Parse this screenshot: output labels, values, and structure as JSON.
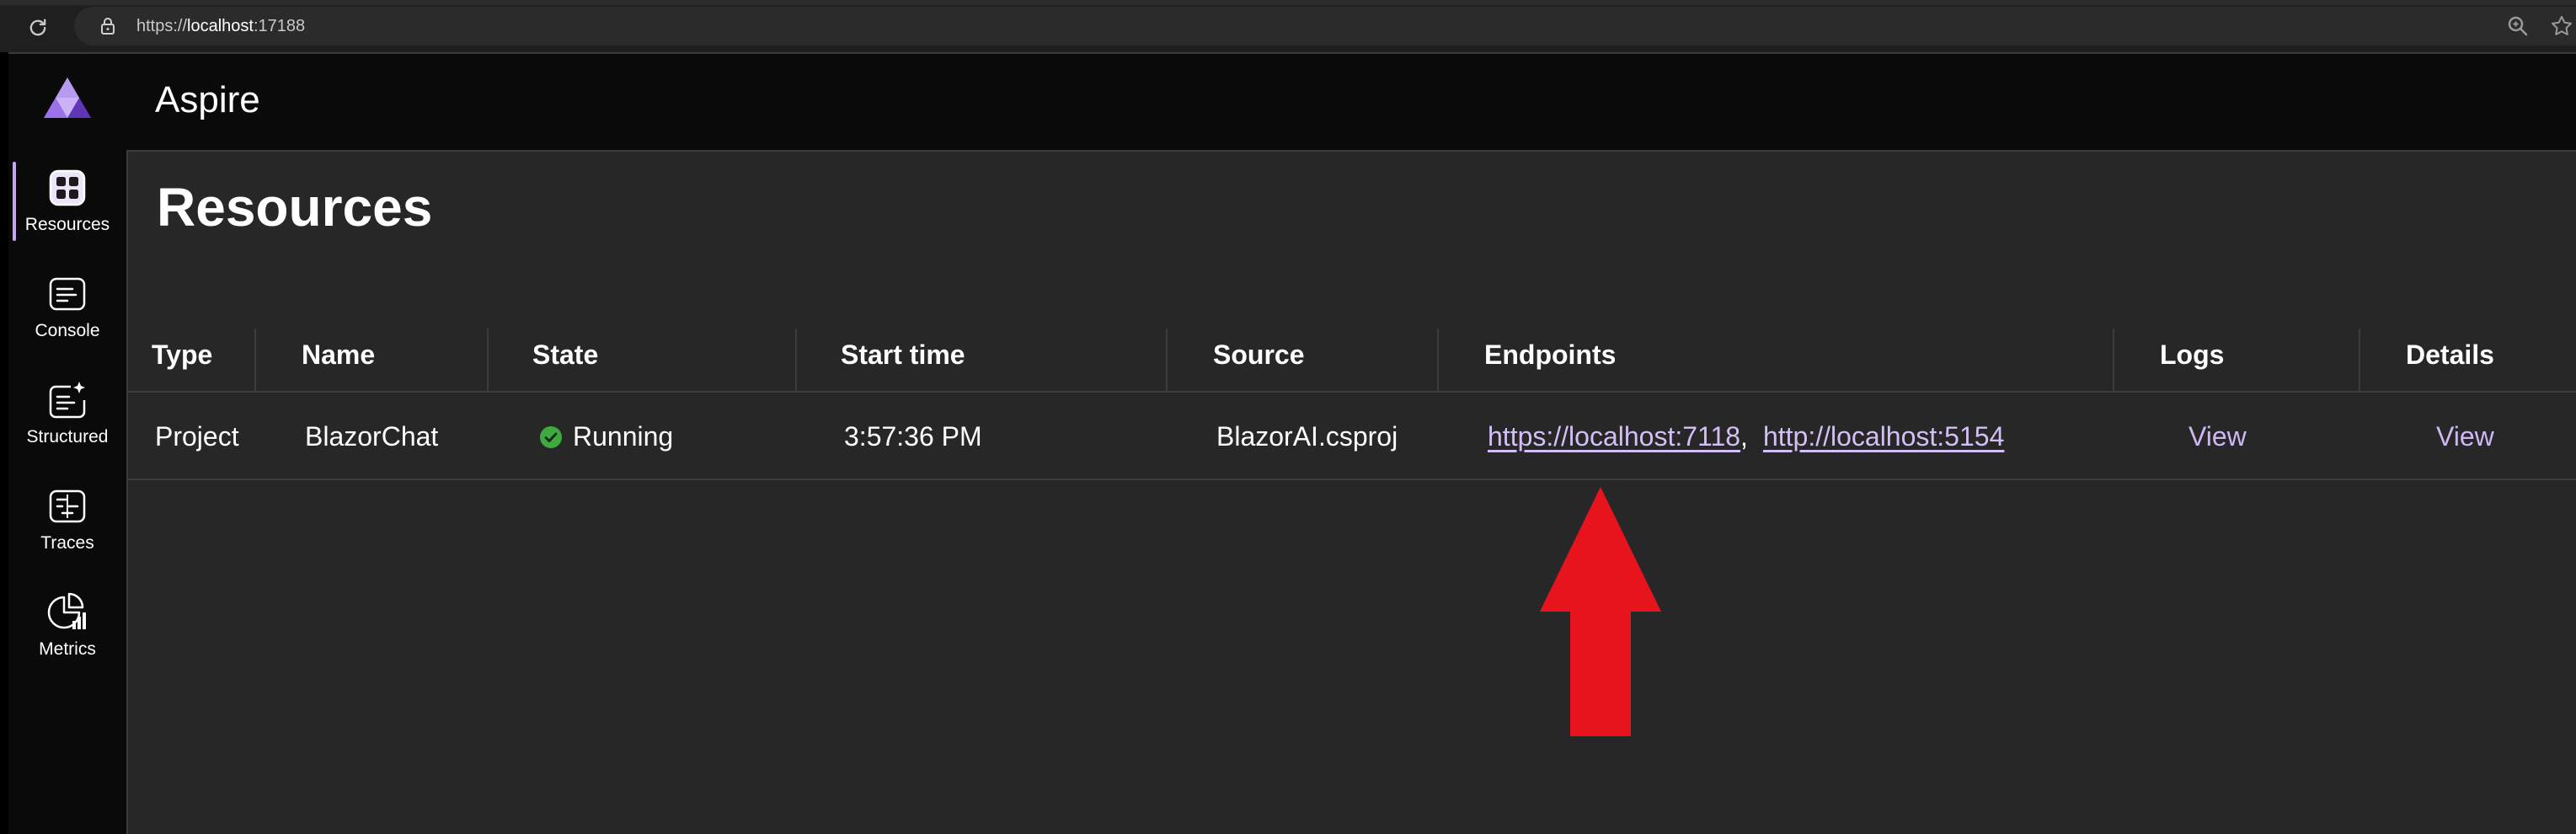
{
  "browser": {
    "url_scheme": "https://",
    "url_host": "localhost",
    "url_port": ":17188"
  },
  "app": {
    "title": "Aspire"
  },
  "sidebar": {
    "items": [
      {
        "label": "Resources",
        "icon": "grid-icon",
        "active": true
      },
      {
        "label": "Console",
        "icon": "console-icon",
        "active": false
      },
      {
        "label": "Structured",
        "icon": "structured-logs-icon",
        "active": false
      },
      {
        "label": "Traces",
        "icon": "traces-icon",
        "active": false
      },
      {
        "label": "Metrics",
        "icon": "metrics-icon",
        "active": false
      }
    ]
  },
  "page": {
    "title": "Resources"
  },
  "table": {
    "columns": [
      "Type",
      "Name",
      "State",
      "Start time",
      "Source",
      "Endpoints",
      "Logs",
      "Details"
    ],
    "rows": [
      {
        "type": "Project",
        "name": "BlazorChat",
        "state": "Running",
        "start_time": "3:57:36 PM",
        "source": "BlazorAI.csproj",
        "endpoints": [
          "https://localhost:7118",
          "http://localhost:5154"
        ],
        "endpoint_separator": ",",
        "logs": "View",
        "details": "View"
      }
    ]
  },
  "colors": {
    "accent": "#cfb6f5",
    "running": "#3fa83f",
    "annotation_arrow": "#e8141d"
  }
}
